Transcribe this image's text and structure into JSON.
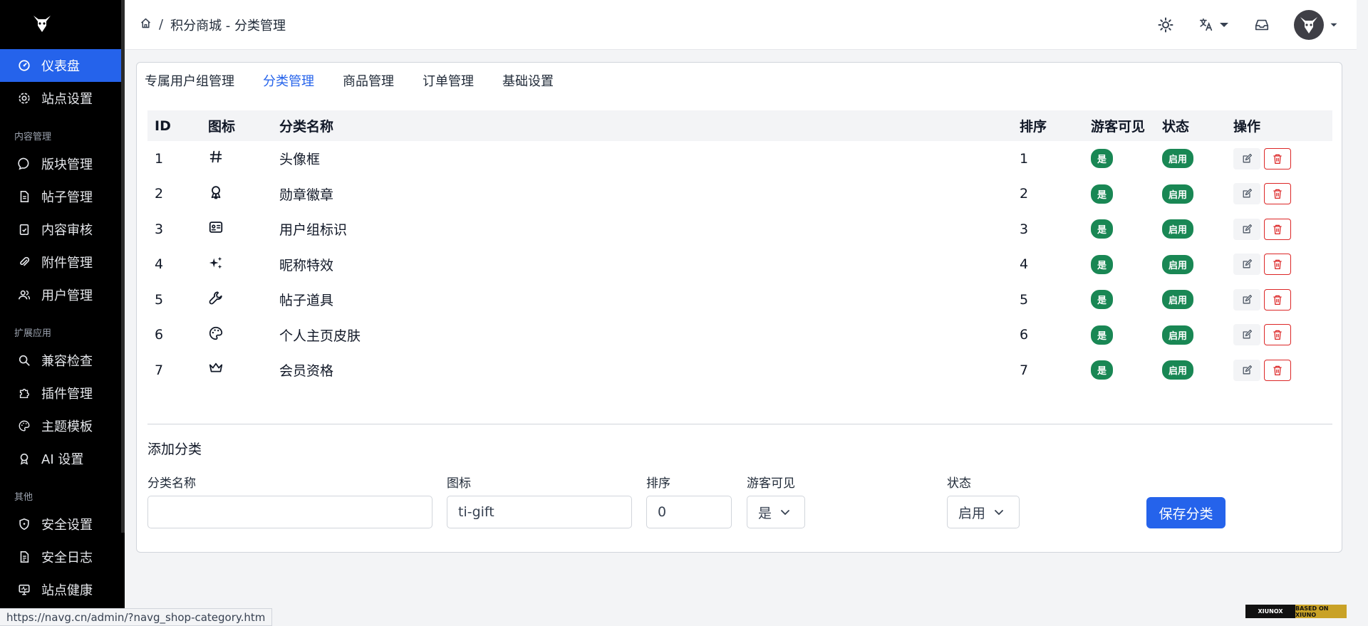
{
  "sidebar": {
    "items": [
      {
        "label": "仪表盘",
        "icon": "dashboard-icon",
        "active": true
      },
      {
        "label": "站点设置",
        "icon": "gear-icon"
      }
    ],
    "sections": [
      {
        "title": "内容管理",
        "items": [
          {
            "label": "版块管理",
            "icon": "message-circle-icon"
          },
          {
            "label": "帖子管理",
            "icon": "file-icon"
          },
          {
            "label": "内容审核",
            "icon": "clipboard-check-icon"
          },
          {
            "label": "附件管理",
            "icon": "paperclip-icon"
          },
          {
            "label": "用户管理",
            "icon": "users-icon"
          }
        ]
      },
      {
        "title": "扩展应用",
        "items": [
          {
            "label": "兼容检查",
            "icon": "search-icon"
          },
          {
            "label": "插件管理",
            "icon": "puzzle-icon"
          },
          {
            "label": "主题模板",
            "icon": "palette-icon"
          },
          {
            "label": "AI 设置",
            "icon": "award-icon"
          }
        ]
      },
      {
        "title": "其他",
        "items": [
          {
            "label": "安全设置",
            "icon": "shield-icon"
          },
          {
            "label": "安全日志",
            "icon": "file-text-icon"
          },
          {
            "label": "站点健康",
            "icon": "monitor-icon"
          }
        ]
      }
    ]
  },
  "breadcrumb": {
    "page": "积分商城 - 分类管理"
  },
  "tabs": [
    {
      "label": "专属用户组管理"
    },
    {
      "label": "分类管理",
      "active": true
    },
    {
      "label": "商品管理"
    },
    {
      "label": "订单管理"
    },
    {
      "label": "基础设置"
    }
  ],
  "table": {
    "headers": {
      "id": "ID",
      "icon": "图标",
      "name": "分类名称",
      "sort": "排序",
      "guest": "游客可见",
      "status": "状态",
      "actions": "操作"
    },
    "rows": [
      {
        "id": "1",
        "icon": "hash-icon",
        "name": "头像框",
        "sort": "1",
        "guest": "是",
        "status": "启用"
      },
      {
        "id": "2",
        "icon": "award-icon",
        "name": "勋章徽章",
        "sort": "2",
        "guest": "是",
        "status": "启用"
      },
      {
        "id": "3",
        "icon": "id-card-icon",
        "name": "用户组标识",
        "sort": "3",
        "guest": "是",
        "status": "启用"
      },
      {
        "id": "4",
        "icon": "sparkles-icon",
        "name": "昵称特效",
        "sort": "4",
        "guest": "是",
        "status": "启用"
      },
      {
        "id": "5",
        "icon": "wrench-icon",
        "name": "帖子道具",
        "sort": "5",
        "guest": "是",
        "status": "启用"
      },
      {
        "id": "6",
        "icon": "palette-icon",
        "name": "个人主页皮肤",
        "sort": "6",
        "guest": "是",
        "status": "启用"
      },
      {
        "id": "7",
        "icon": "crown-icon",
        "name": "会员资格",
        "sort": "7",
        "guest": "是",
        "status": "启用"
      }
    ]
  },
  "form": {
    "title": "添加分类",
    "name_label": "分类名称",
    "name_value": "",
    "icon_label": "图标",
    "icon_value": "ti-gift",
    "sort_label": "排序",
    "sort_value": "0",
    "guest_label": "游客可见",
    "guest_value": "是",
    "status_label": "状态",
    "status_value": "启用",
    "save_label": "保存分类"
  },
  "statusbar": {
    "url": "https://navg.cn/admin/?navg_shop-category.htm"
  },
  "footer_badge": {
    "left": "XIUNOX",
    "right": "BASED ON XIUNO"
  },
  "colors": {
    "accent": "#2563eb",
    "success": "#198754",
    "danger": "#dc2626",
    "sidebar": "#000000"
  }
}
